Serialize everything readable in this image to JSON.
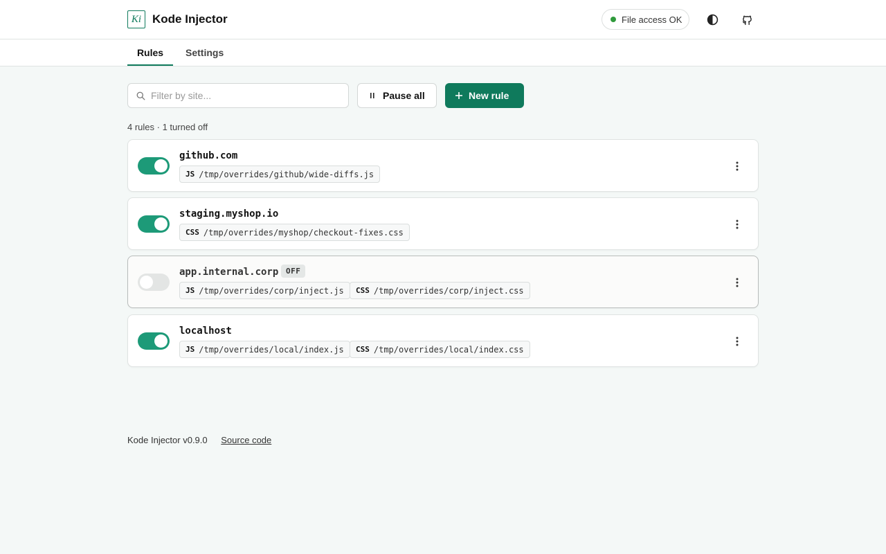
{
  "app": {
    "title": "Kode Injector",
    "logo_text": "Ki"
  },
  "header": {
    "status": "File access OK",
    "theme_icon": "contrast-icon",
    "github_icon": "github-icon"
  },
  "tabs": [
    {
      "label": "Rules",
      "active": true
    },
    {
      "label": "Settings",
      "active": false
    }
  ],
  "toolbar": {
    "search_placeholder": "Filter by site...",
    "search_value": "",
    "pause_label": "Pause all",
    "new_label": "New rule"
  },
  "summary": "4 rules · 1 turned off",
  "rules": [
    {
      "host": "github.com",
      "enabled": true,
      "files": [
        {
          "kind": "JS",
          "path": "/tmp/overrides/github/wide-diffs.js"
        }
      ]
    },
    {
      "host": "staging.myshop.io",
      "enabled": true,
      "files": [
        {
          "kind": "CSS",
          "path": "/tmp/overrides/myshop/checkout-fixes.css"
        }
      ]
    },
    {
      "host": "app.internal.corp",
      "enabled": false,
      "badge": "OFF",
      "files": [
        {
          "kind": "JS",
          "path": "/tmp/overrides/corp/inject.js"
        },
        {
          "kind": "CSS",
          "path": "/tmp/overrides/corp/inject.css"
        }
      ]
    },
    {
      "host": "localhost",
      "enabled": true,
      "files": [
        {
          "kind": "JS",
          "path": "/tmp/overrides/local/index.js"
        },
        {
          "kind": "CSS",
          "path": "/tmp/overrides/local/index.css"
        }
      ]
    }
  ],
  "footer": {
    "version": "Kode Injector v0.9.0",
    "source_link": "Source code"
  },
  "colors": {
    "accent": "#0f7a5c",
    "toggle_on": "#1d9a78",
    "status_ok": "#2f9a3c"
  }
}
